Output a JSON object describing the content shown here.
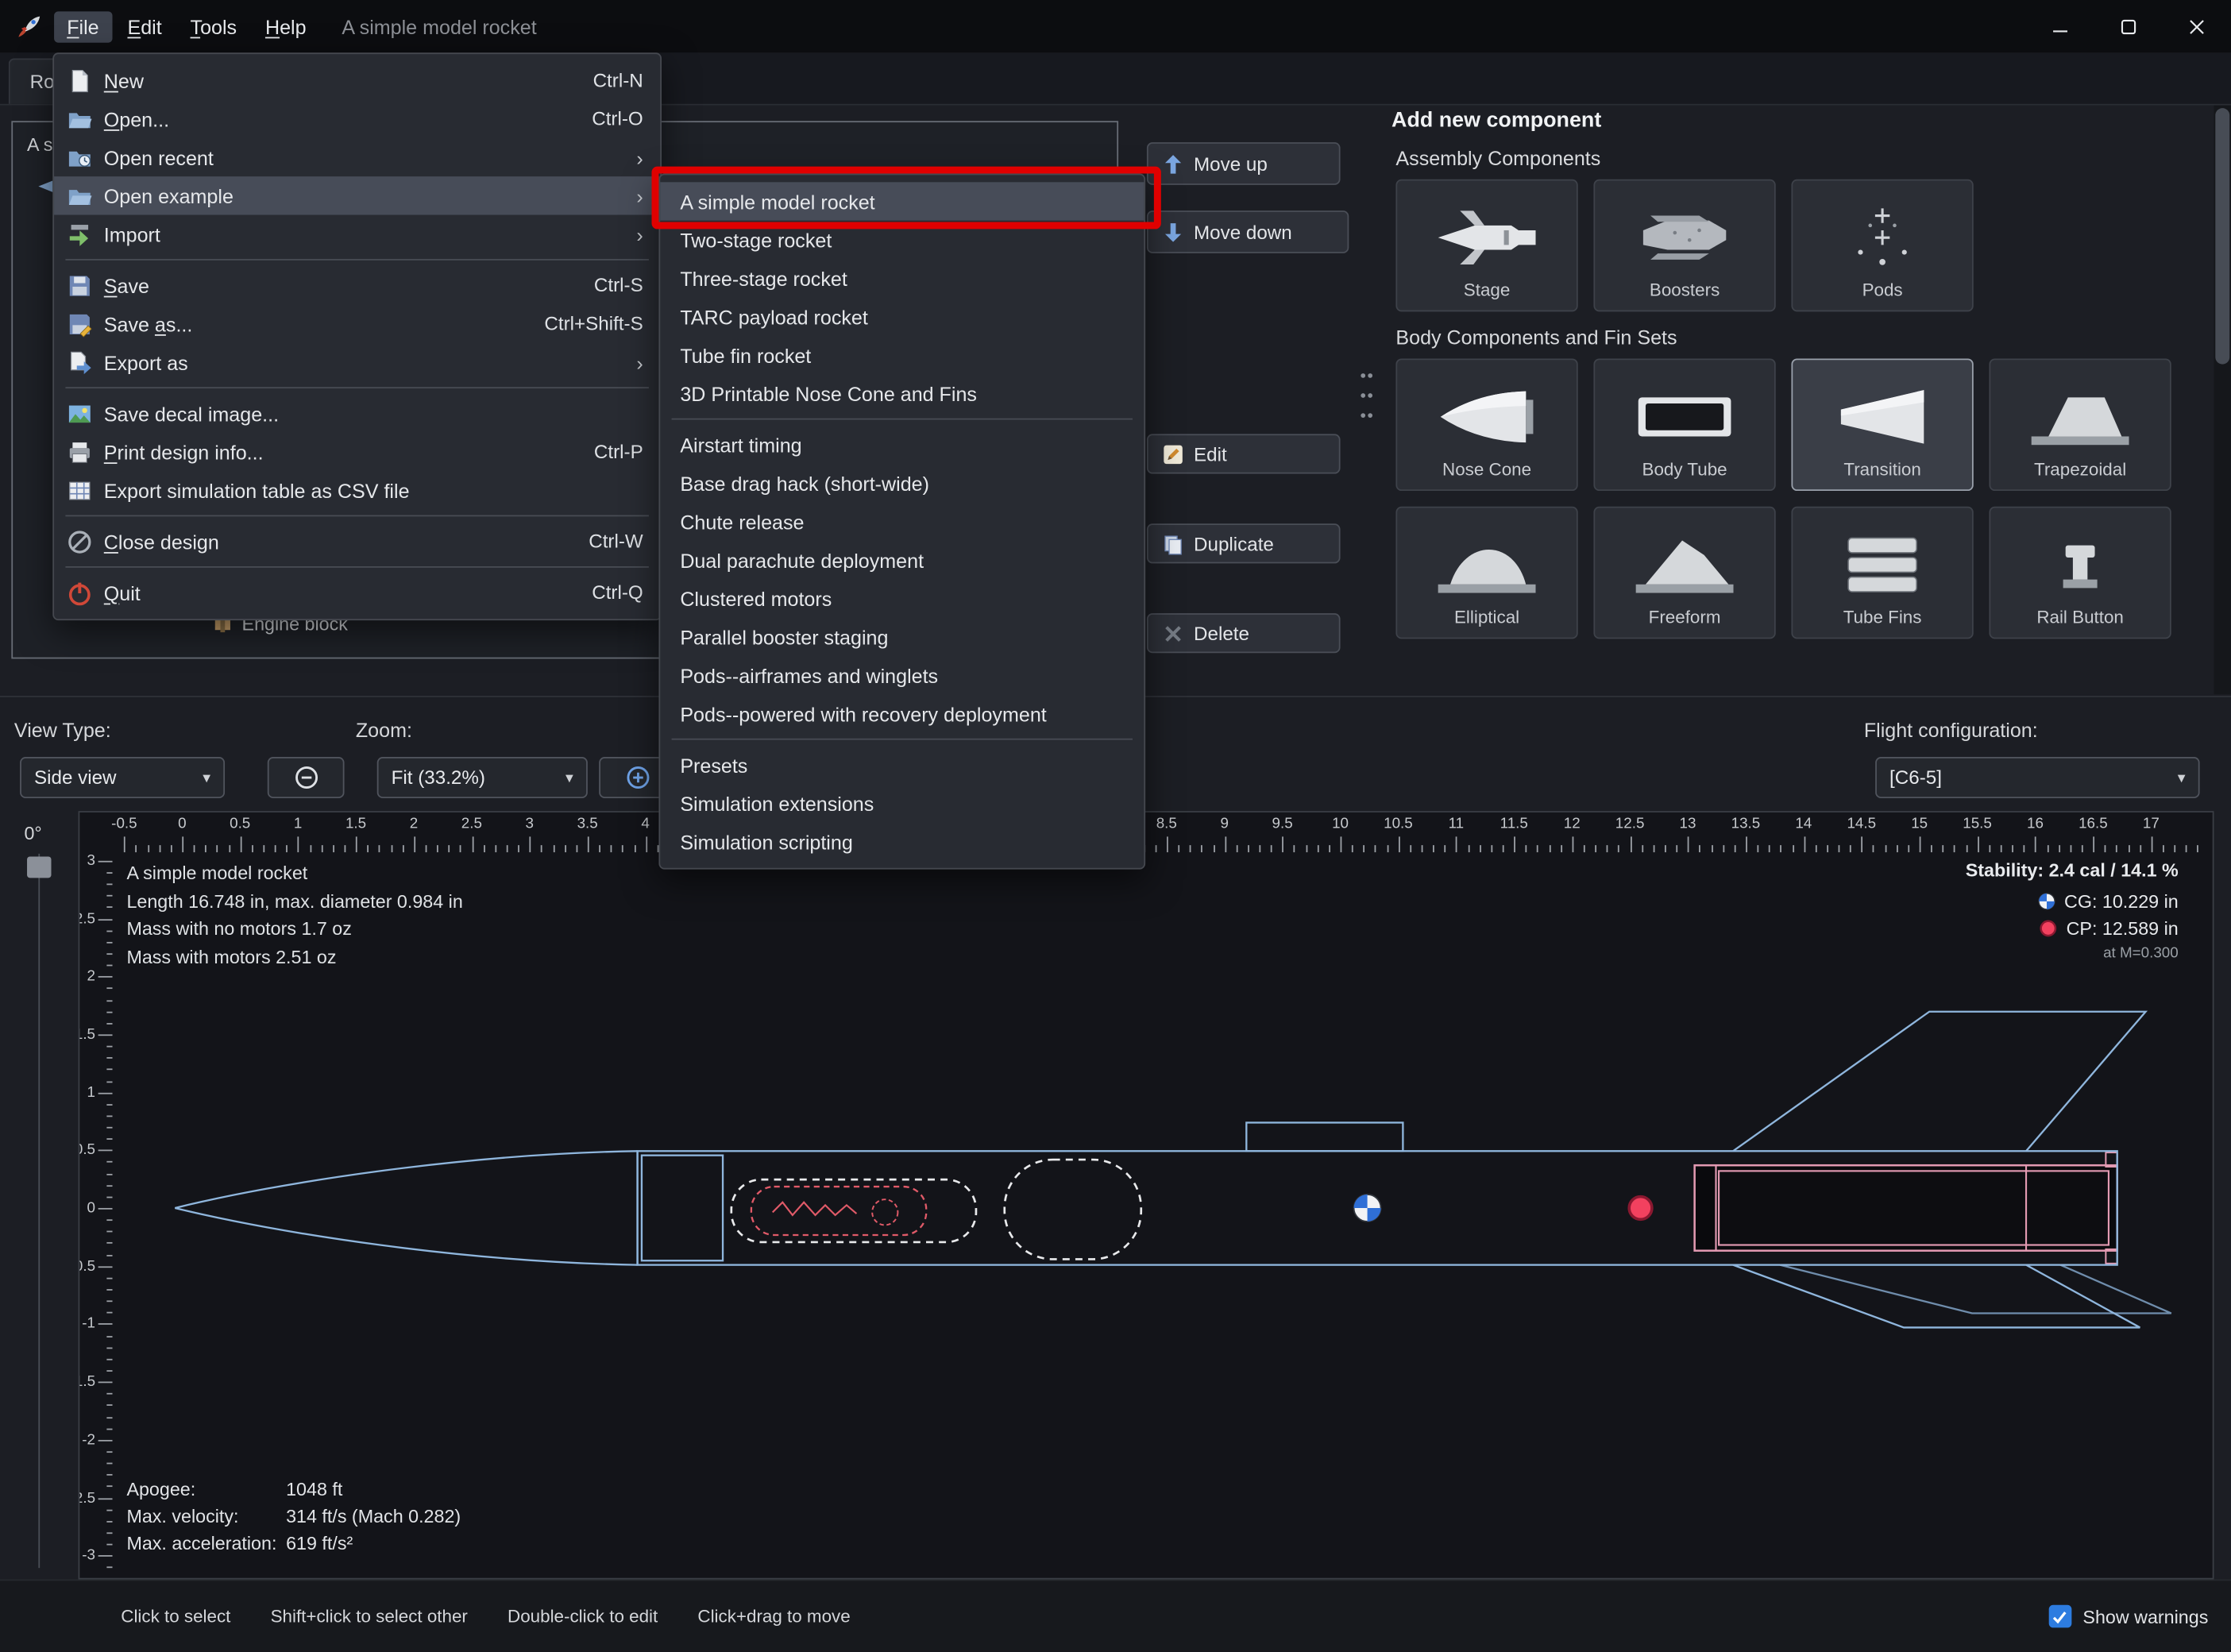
{
  "titlebar": {
    "title": "A simple model rocket",
    "menus": [
      {
        "label": "File",
        "active": true
      },
      {
        "label": "Edit"
      },
      {
        "label": "Tools"
      },
      {
        "label": "Help"
      }
    ]
  },
  "tabs": {
    "left_tab": "Rocket"
  },
  "design_tree": {
    "root": "A simple model rocket",
    "visible_item": "Engine block"
  },
  "file_menu": {
    "groups": [
      [
        {
          "icon": "new-document-icon",
          "label": "New",
          "shortcut": "Ctrl-N",
          "underline_index": 0
        },
        {
          "icon": "open-folder-icon",
          "label": "Open...",
          "shortcut": "Ctrl-O",
          "underline_index": 0
        },
        {
          "icon": "recent-folder-icon",
          "label": "Open recent",
          "submenu": true
        },
        {
          "icon": "example-folder-icon",
          "label": "Open example",
          "submenu": true,
          "highlighted": true
        },
        {
          "icon": "import-icon",
          "label": "Import",
          "submenu": true
        }
      ],
      [
        {
          "icon": "save-icon",
          "label": "Save",
          "shortcut": "Ctrl-S",
          "underline_index": 0
        },
        {
          "icon": "save-as-icon",
          "label": "Save as...",
          "shortcut": "Ctrl+Shift-S",
          "underline_index": 5
        },
        {
          "icon": "export-icon",
          "label": "Export as",
          "submenu": true
        }
      ],
      [
        {
          "icon": "decal-image-icon",
          "label": "Save decal image..."
        },
        {
          "icon": "printer-icon",
          "label": "Print design info...",
          "shortcut": "Ctrl-P",
          "underline_index": 0
        },
        {
          "icon": "csv-table-icon",
          "label": "Export simulation table as CSV file"
        }
      ],
      [
        {
          "icon": "close-design-icon",
          "label": "Close design",
          "shortcut": "Ctrl-W",
          "underline_index": 0
        }
      ],
      [
        {
          "icon": "quit-icon",
          "label": "Quit",
          "shortcut": "Ctrl-Q",
          "underline_index": 0
        }
      ]
    ]
  },
  "example_submenu": {
    "selected": "A simple model rocket",
    "groups": [
      [
        "A simple model rocket",
        "Two-stage rocket",
        "Three-stage rocket",
        "TARC payload rocket",
        "Tube fin rocket",
        "3D Printable Nose Cone and Fins"
      ],
      [
        "Airstart timing",
        "Base drag hack (short-wide)",
        "Chute release",
        "Dual parachute deployment",
        "Clustered motors",
        "Parallel booster staging",
        "Pods--airframes and winglets",
        "Pods--powered with recovery deployment"
      ],
      [
        "Presets",
        "Simulation extensions",
        "Simulation scripting"
      ]
    ]
  },
  "component_actions": {
    "move_up": "Move up",
    "move_down": "Move down",
    "edit": "Edit",
    "duplicate": "Duplicate",
    "delete": "Delete"
  },
  "add_component_panel": {
    "title": "Add new component",
    "sections": [
      {
        "heading": "Assembly Components",
        "tiles": [
          {
            "label": "Stage",
            "icon": "stage-icon"
          },
          {
            "label": "Boosters",
            "icon": "boosters-icon"
          },
          {
            "label": "Pods",
            "icon": "pods-icon"
          }
        ]
      },
      {
        "heading": "Body Components and Fin Sets",
        "tiles": [
          {
            "label": "Nose Cone",
            "icon": "nose-cone-icon"
          },
          {
            "label": "Body Tube",
            "icon": "body-tube-icon"
          },
          {
            "label": "Transition",
            "icon": "transition-icon",
            "highlighted": true
          },
          {
            "label": "Trapezoidal",
            "icon": "trapezoidal-fin-icon"
          },
          {
            "label": "Elliptical",
            "icon": "elliptical-fin-icon"
          },
          {
            "label": "Freeform",
            "icon": "freeform-fin-icon"
          },
          {
            "label": "Tube Fins",
            "icon": "tube-fins-icon"
          },
          {
            "label": "Rail Button",
            "icon": "rail-button-icon"
          }
        ]
      }
    ]
  },
  "view_bar": {
    "view_type_label": "View Type:",
    "view_type_value": "Side view",
    "zoom_label": "Zoom:",
    "zoom_value": "Fit (33.2%)",
    "flight_config_label": "Flight configuration:",
    "flight_config_value": "[C6-5]"
  },
  "canvas": {
    "rotation": "0°",
    "info_lines": [
      "A simple model rocket",
      "Length 16.748 in, max. diameter 0.984 in",
      "Mass with no motors 1.7 oz",
      "Mass with motors 2.51 oz"
    ],
    "stability": {
      "line": "Stability: 2.4 cal / 14.1 %",
      "cg": "CG: 10.229 in",
      "cp": "CP: 12.589 in",
      "mach": "at M=0.300"
    },
    "stats": [
      {
        "label": "Apogee:",
        "value": "1048 ft"
      },
      {
        "label": "Max. velocity:",
        "value": "314 ft/s  (Mach 0.282)"
      },
      {
        "label": "Max. acceleration:",
        "value": "619 ft/s²"
      }
    ],
    "ruler": {
      "h_min": -0.5,
      "h_max": 17.0,
      "v_min": -3.0,
      "v_max": 2.5,
      "label_step": 0.5,
      "units": "in"
    }
  },
  "status_bar": {
    "hints": [
      "Click to select",
      "Shift+click to select other",
      "Double-click to edit",
      "Click+drag to move"
    ],
    "show_warnings": "Show warnings",
    "checked": true
  },
  "colors": {
    "annotation_red": "#e00000",
    "cg_blue": "#2f6fd6",
    "cp_red": "#f2415f",
    "rocket_outline": "#8fb6dd",
    "motor_pink": "#e39ab2"
  }
}
